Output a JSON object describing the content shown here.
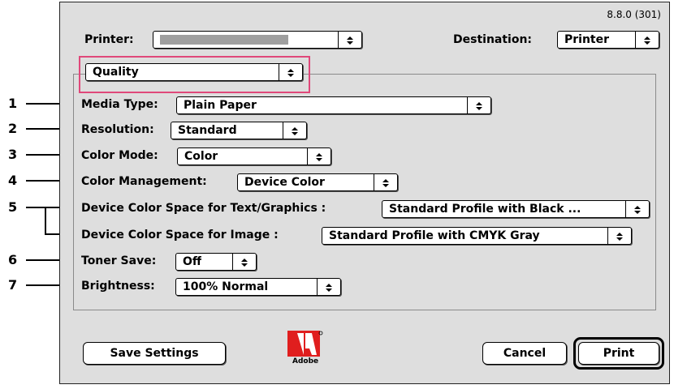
{
  "version": "8.8.0 (301)",
  "printer": {
    "label": "Printer:",
    "value": ""
  },
  "destination": {
    "label": "Destination:",
    "value": "Printer"
  },
  "panel_popup": {
    "value": "Quality"
  },
  "settings": [
    {
      "label": "Media Type:",
      "value": "Plain Paper"
    },
    {
      "label": "Resolution:",
      "value": "Standard"
    },
    {
      "label": "Color Mode:",
      "value": "Color"
    },
    {
      "label": "Color Management:",
      "value": "Device Color"
    },
    {
      "label": "Device Color Space for Text/Graphics :",
      "value": "Standard Profile with Black ..."
    },
    {
      "label": "Device Color Space for Image :",
      "value": "Standard Profile with CMYK Gray"
    },
    {
      "label": "Toner Save:",
      "value": "Off"
    },
    {
      "label": "Brightness:",
      "value": "100% Normal"
    }
  ],
  "callout_numbers": [
    "1",
    "2",
    "3",
    "4",
    "5",
    "6",
    "7"
  ],
  "buttons": {
    "save": "Save Settings",
    "cancel": "Cancel",
    "print": "Print"
  },
  "logo": {
    "text": "Adobe",
    "color": "#e01e1e"
  },
  "colors": {
    "highlight": "#e0487a",
    "dialog_bg": "#dedede"
  }
}
